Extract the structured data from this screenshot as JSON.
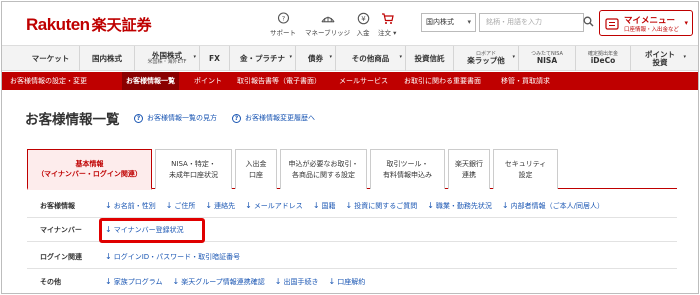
{
  "header": {
    "logo_en": "Rakuten",
    "logo_ja": "楽天証券",
    "icons": [
      {
        "name": "support",
        "label": "サポート"
      },
      {
        "name": "marketbridge",
        "label": "マネーブリッジ"
      },
      {
        "name": "deposit",
        "label": "入金"
      },
      {
        "name": "order",
        "label": "注文"
      }
    ],
    "search_scope": "国内株式",
    "search_placeholder": "銘柄・用語を入力",
    "mymenu_title": "マイメニュー",
    "mymenu_sub": "口座情報・入出金など"
  },
  "nav": {
    "items": [
      {
        "label": "マーケット",
        "sub": ""
      },
      {
        "label": "国内株式",
        "sub": ""
      },
      {
        "label": "外国株式",
        "sub": "米国株・海外ETF"
      },
      {
        "label": "FX",
        "sub": ""
      },
      {
        "label": "金・プラチナ",
        "sub": ""
      },
      {
        "label": "債券",
        "sub": ""
      },
      {
        "label": "その他商品",
        "sub": ""
      },
      {
        "label": "投資信託",
        "sub": ""
      },
      {
        "label": "楽ラップ他",
        "sub": "ロボアド"
      },
      {
        "label": "NISA",
        "sub": "つみたてNISA"
      },
      {
        "label": "iDeCo",
        "sub": "確定拠出年金"
      },
      {
        "label": "ポイント",
        "sub": "投資"
      }
    ]
  },
  "subnav": {
    "items": [
      "お客様情報の設定・変更",
      "お客様情報一覧",
      "ポイント",
      "取引報告書等（電子書面）",
      "メールサービス",
      "お取引に関わる重要書面",
      "移管・買取請求"
    ]
  },
  "page": {
    "title": "お客様情報一覧",
    "help_link": "お客様情報一覧の見方",
    "history_link": "お客様情報変更履歴へ"
  },
  "tabs": [
    {
      "line1": "基本情報",
      "line2": "（マイナンバー・ログイン関連）"
    },
    {
      "line1": "NISA・特定・",
      "line2": "未成年口座状況"
    },
    {
      "line1": "入出金",
      "line2": "口座"
    },
    {
      "line1": "申込が必要なお取引・",
      "line2": "各商品に関する設定"
    },
    {
      "line1": "取引ツール・",
      "line2": "有料情報申込み"
    },
    {
      "line1": "楽天銀行",
      "line2": "連携"
    },
    {
      "line1": "セキュリティ",
      "line2": "設定"
    }
  ],
  "sections": [
    {
      "label": "お客様情報",
      "links": [
        "お名前・性別",
        "ご住所",
        "連絡先",
        "メールアドレス",
        "国籍",
        "投資に関するご質問",
        "職業・勤務先状況",
        "内部者情報（ご本人/同居人）"
      ]
    },
    {
      "label": "マイナンバー",
      "links": [
        "マイナンバー登録状況"
      ]
    },
    {
      "label": "ログイン関連",
      "links": [
        "ログインID・パスワード・取引暗証番号"
      ]
    },
    {
      "label": "その他",
      "links": [
        "家族プログラム",
        "楽天グループ情報連携確認",
        "出国手続き",
        "口座解約"
      ]
    }
  ],
  "icon_arrow": "↓",
  "colors": {
    "brand": "#bf0000",
    "link": "#1a56b3",
    "highlight": "#e00000"
  }
}
